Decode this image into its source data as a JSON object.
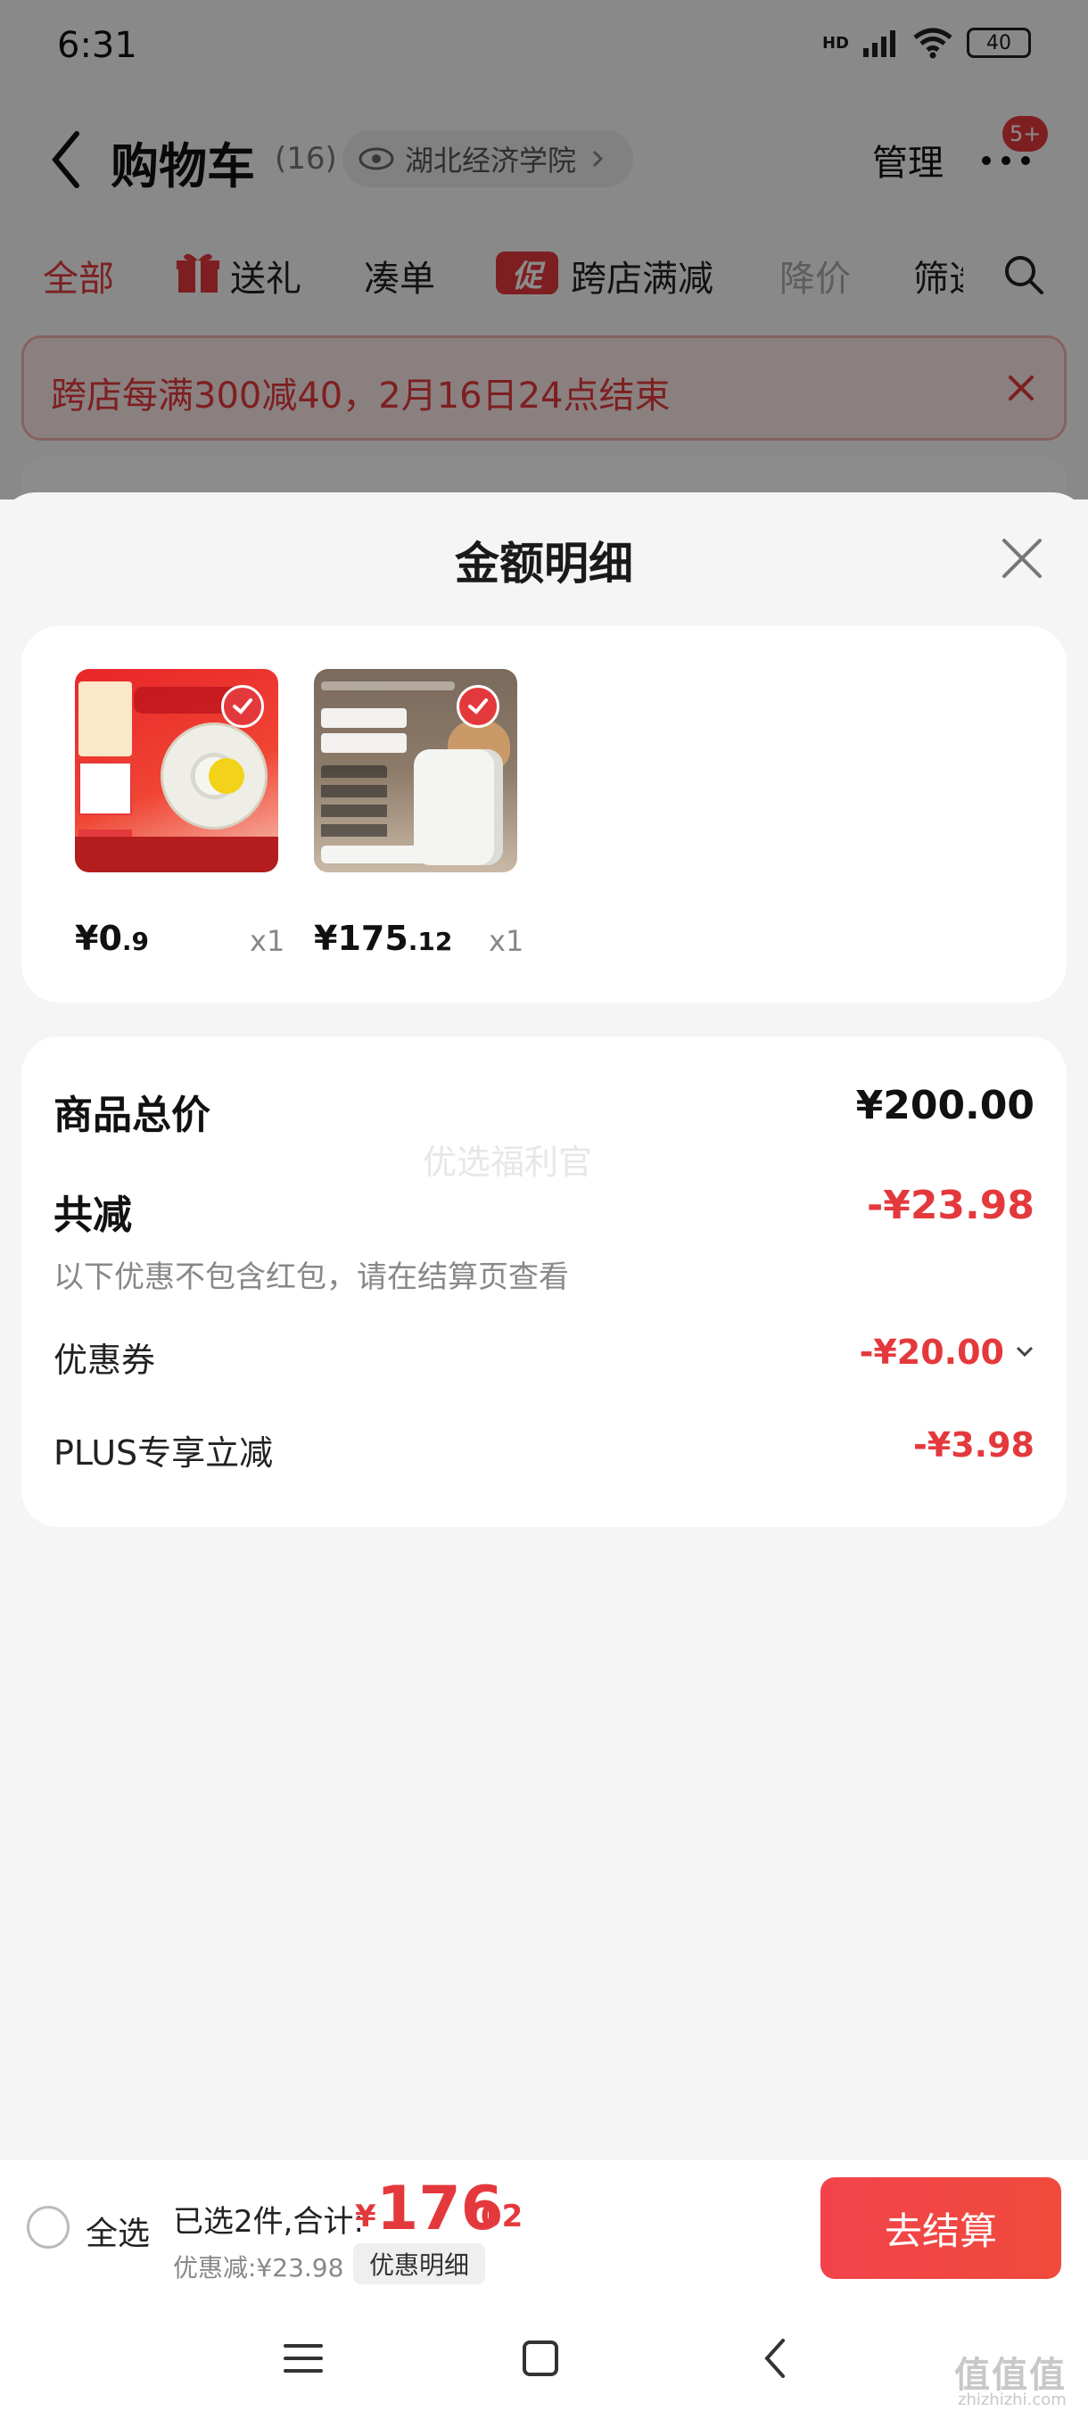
{
  "status_bar": {
    "time": "6:31",
    "signal_label": "HD",
    "battery": "40"
  },
  "cart_header": {
    "title": "购物车",
    "count": "(16)",
    "location": "湖北经济学院",
    "manage": "管理",
    "badge": "5+"
  },
  "filter_tabs": [
    {
      "label": "全部"
    },
    {
      "label": "送礼"
    },
    {
      "label": "凑单"
    },
    {
      "label": "促",
      "badge": true
    },
    {
      "label": "跨店满减"
    },
    {
      "label": "降价"
    },
    {
      "label": "筛选"
    }
  ],
  "promo_banner": {
    "text": "跨店每满300减40，2月16日24点结束"
  },
  "sheet": {
    "title": "金额明细",
    "products": [
      {
        "price_int": "¥0",
        "price_dec": ".9",
        "qty": "x1",
        "image": "tape-roll"
      },
      {
        "price_int": "¥175",
        "price_dec": ".12",
        "qty": "x1",
        "image": "pet-water-dispenser"
      }
    ],
    "summary": {
      "subtotal_label": "商品总价",
      "subtotal_value": "¥200.00",
      "discount_label": "共减",
      "discount_value": "-¥23.98",
      "watermark": "优选福利官",
      "note": "以下优惠不包含红包，请在结算页查看",
      "coupon_label": "优惠券",
      "coupon_value": "-¥20.00",
      "plus_label": "PLUS专享立减",
      "plus_value": "-¥3.98"
    }
  },
  "checkout": {
    "select_all": "全选",
    "selected_text": "已选2件,合计:",
    "total_yen": "¥",
    "total_int": "176",
    "total_dec": ".02",
    "discount_text": "优惠减:¥23.98",
    "detail_button": "优惠明细",
    "checkout_button": "去结算"
  },
  "watermark_site": {
    "mark": "值值值",
    "url": "zhizhizhi.com"
  },
  "colors": {
    "accent": "#e4393c",
    "sheet_bg": "#f5f5f5"
  }
}
